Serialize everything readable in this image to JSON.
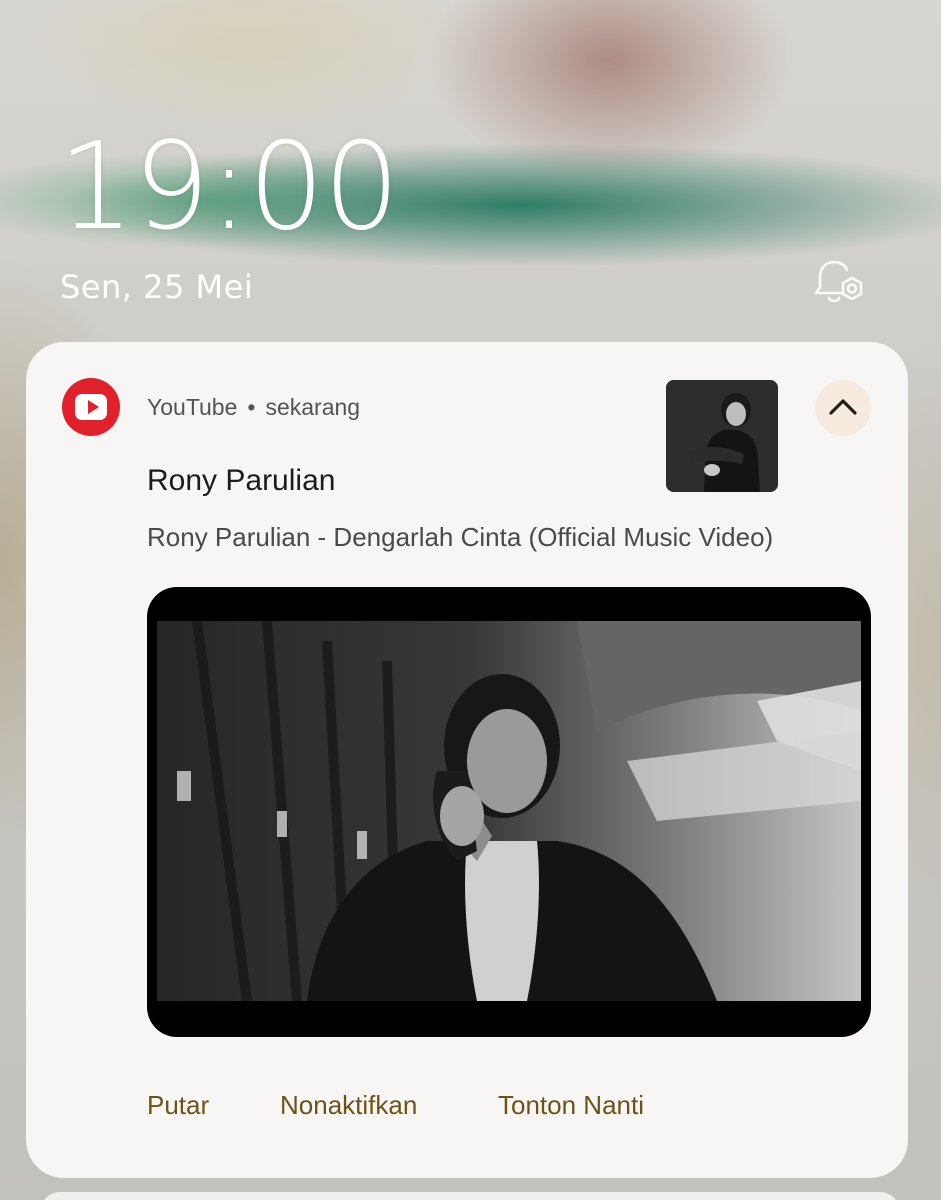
{
  "lockscreen": {
    "time": "19:00",
    "date": "Sen, 25 Mei",
    "settings_icon": "bell-settings-icon"
  },
  "notification": {
    "app_name": "YouTube",
    "separator": "•",
    "time_ago": "sekarang",
    "app_icon": "youtube-icon",
    "collapse_icon": "chevron-up-icon",
    "title": "Rony Parulian",
    "text": "Rony Parulian - Dengarlah Cinta (Official Music Video)",
    "actions": [
      "Putar",
      "Nonaktifkan",
      "Tonton Nanti"
    ],
    "colors": {
      "youtube_red": "#e0202b",
      "action_text": "#6b5417",
      "collapse_bg": "#f6ebde",
      "card_bg": "#f7f6f5"
    }
  }
}
